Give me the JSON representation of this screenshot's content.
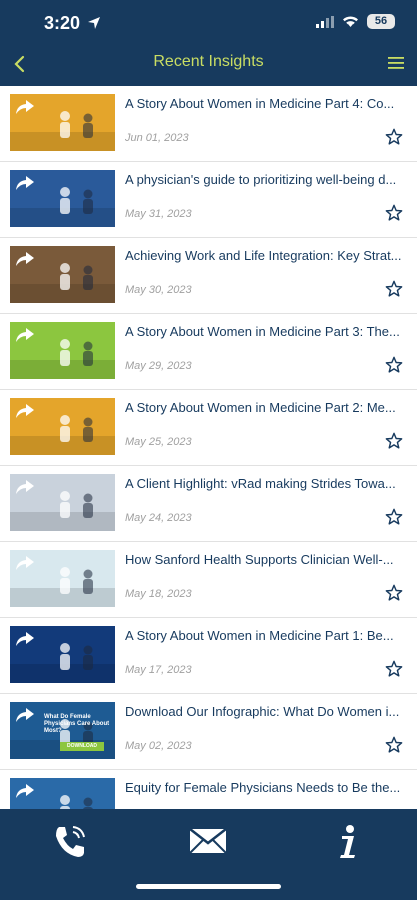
{
  "status": {
    "time": "3:20",
    "battery": "56"
  },
  "header": {
    "title": "Recent Insights"
  },
  "articles": [
    {
      "title": "A Story About Women in Medicine Part 4: Co...",
      "date": "Jun 01, 2023",
      "thumb_color": "#e4a52b"
    },
    {
      "title": "A physician's guide to prioritizing well-being d...",
      "date": "May 31, 2023",
      "thumb_color": "#2a5a9a"
    },
    {
      "title": "Achieving Work and Life Integration: Key Strat...",
      "date": "May 30, 2023",
      "thumb_color": "#7a5a3a"
    },
    {
      "title": "A Story About Women in Medicine Part 3: The...",
      "date": "May 29, 2023",
      "thumb_color": "#8cc63f"
    },
    {
      "title": "A Story About Women in Medicine Part 2: Me...",
      "date": "May 25, 2023",
      "thumb_color": "#e4a52b"
    },
    {
      "title": "A Client Highlight: vRad making Strides Towa...",
      "date": "May 24, 2023",
      "thumb_color": "#c9d2dc"
    },
    {
      "title": "How Sanford Health Supports Clinician Well-...",
      "date": "May 18, 2023",
      "thumb_color": "#d8e8ee"
    },
    {
      "title": "A Story About Women in Medicine Part 1: Be...",
      "date": "May 17, 2023",
      "thumb_color": "#123a7a"
    },
    {
      "title": "Download Our Infographic: What Do Women i...",
      "date": "May 02, 2023",
      "thumb_color": "#1e5b93",
      "thumb_text": "What Do Female Physicians Care About Most?",
      "thumb_button": "DOWNLOAD"
    },
    {
      "title": "Equity for Female Physicians Needs to Be the...",
      "date": "",
      "thumb_color": "#2a6aa8"
    }
  ],
  "colors": {
    "navy": "#173a5e",
    "accent": "#c9dd63"
  },
  "tabbar": {
    "icons": [
      "phone-icon",
      "mail-icon",
      "info-icon"
    ]
  }
}
